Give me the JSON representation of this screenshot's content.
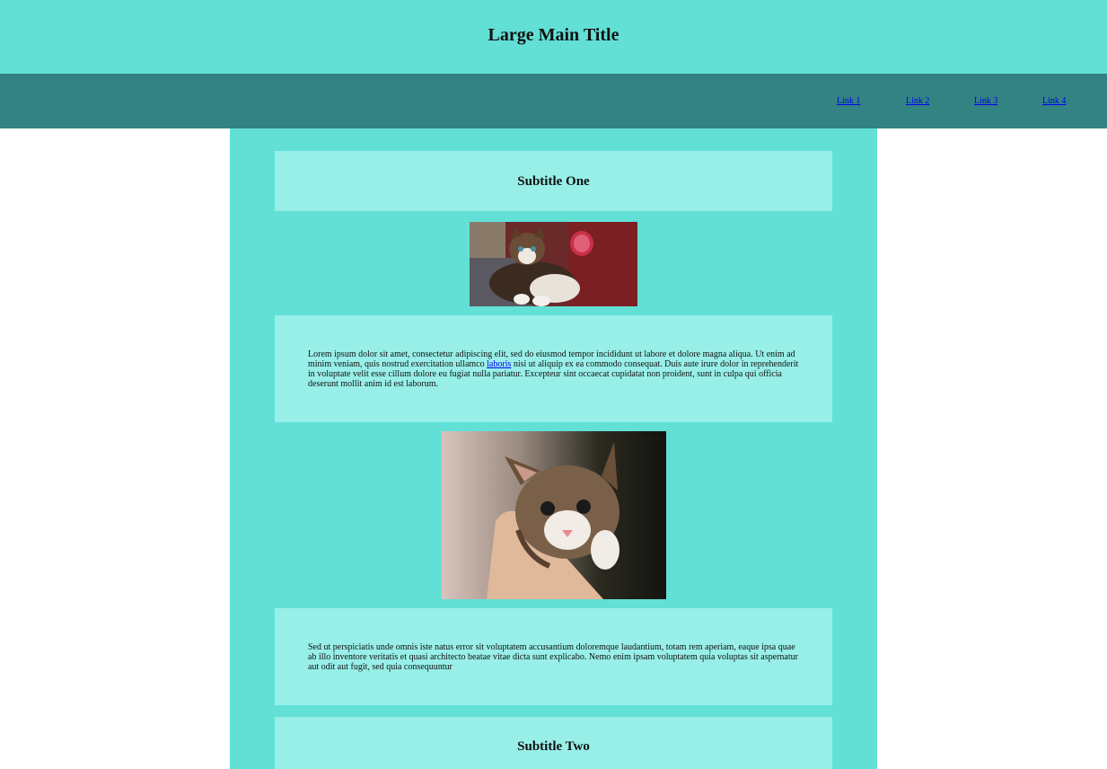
{
  "header": {
    "title": "Large Main Title"
  },
  "nav": {
    "links": [
      "Link 1",
      "Link 2",
      "Link 3",
      "Link 4"
    ]
  },
  "sections": {
    "subtitle_one": "Subtitle One",
    "para1": {
      "before": "Lorem ipsum dolor sit amet, consectetur adipiscing elit, sed do eiusmod tempor incididunt ut labore et dolore magna aliqua. Ut enim ad minim veniam, quis nostrud exercitation ullamco ",
      "link": "laboris",
      "after": " nisi ut aliquip ex ea commodo consequat. Duis aute irure dolor in reprehenderit in voluptate velit esse cillum dolore eu fugiat nulla pariatur. Excepteur sint occaecat cupidatat non proident, sunt in culpa qui officia deserunt mollit anim id est laborum."
    },
    "para2": "Sed ut perspiciatis unde omnis iste natus error sit voluptatem accusantium doloremque laudantium, totam rem aperiam, eaque ipsa quae ab illo inventore veritatis et quasi architecto beatae vitae dicta sunt explicabo. Nemo enim ipsam voluptatem quia voluptas sit aspernatur aut odit aut fugit, sed quia consequuntur",
    "subtitle_two": "Subtitle Two"
  },
  "images": {
    "kitten_one": "kitten-photo",
    "kitten_two": "kitten-in-hand-photo"
  },
  "colors": {
    "header_bg": "#62e0d6",
    "nav_bg": "#338383",
    "main_bg": "#62e0d6",
    "box_bg": "#98efe8",
    "link": "#0000ee"
  }
}
